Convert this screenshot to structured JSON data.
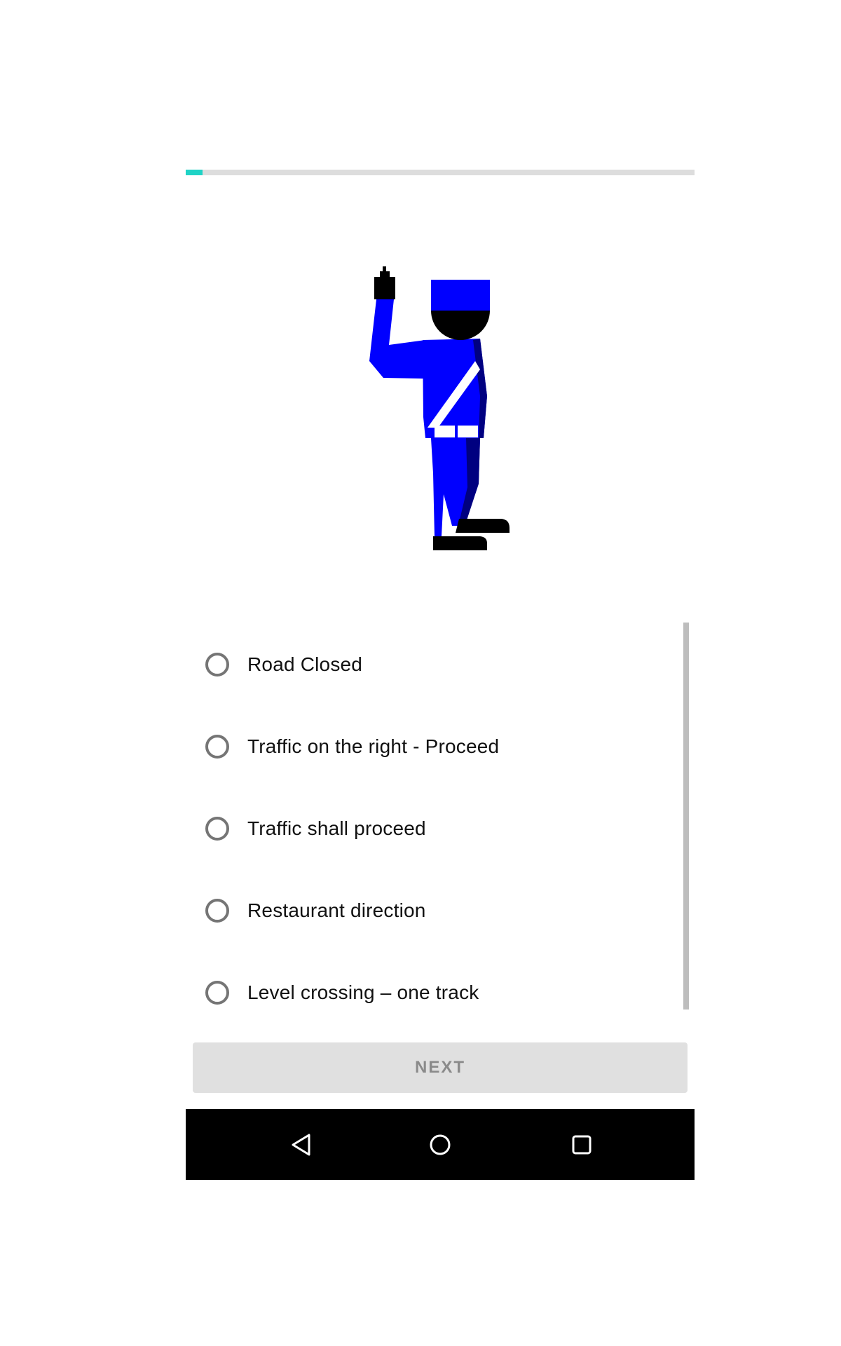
{
  "progress": {
    "fraction": 0.033,
    "accent_color": "#1fd3c6",
    "track_color": "#dddddd"
  },
  "illustration": {
    "icon": "traffic-police-raised-arm-icon",
    "uniform_color": "#0000ff",
    "shadow_color": "#000080"
  },
  "options": [
    {
      "label": "Road Closed",
      "selected": false
    },
    {
      "label": "Traffic on the right - Proceed",
      "selected": false
    },
    {
      "label": "Traffic shall proceed",
      "selected": false
    },
    {
      "label": "Restaurant direction",
      "selected": false
    },
    {
      "label": "Level crossing – one track",
      "selected": false
    }
  ],
  "next_button": {
    "label": "NEXT",
    "enabled": false
  },
  "navbar": {
    "back_icon": "back-triangle-icon",
    "home_icon": "home-circle-icon",
    "recents_icon": "recents-square-icon"
  }
}
